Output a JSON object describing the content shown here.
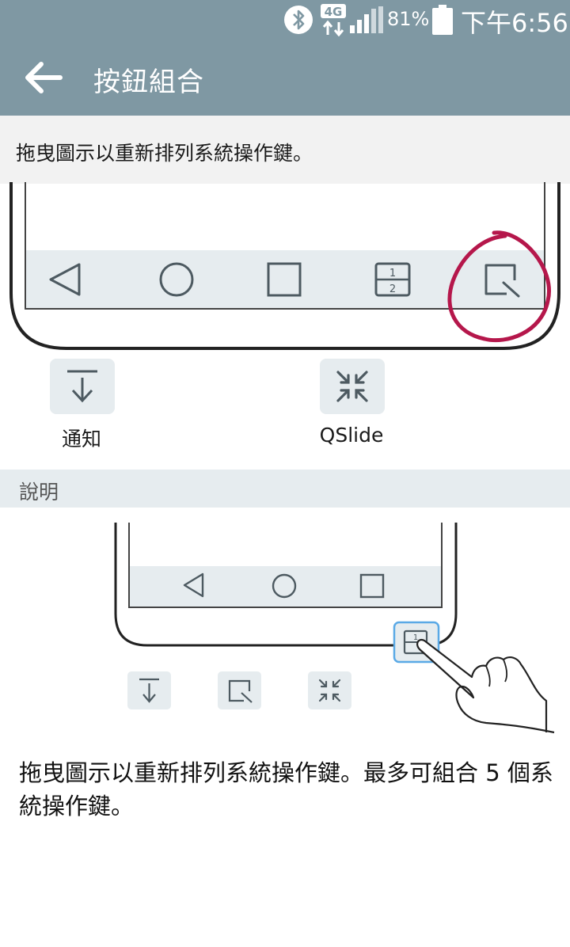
{
  "status_bar": {
    "network_label": "4G",
    "battery_percent": "81%",
    "time": "下午6:56",
    "icons": [
      "bluetooth-icon",
      "network-4g-icon",
      "signal-icon",
      "battery-icon"
    ]
  },
  "app_bar": {
    "title": "按鈕組合",
    "back_icon": "arrow-left-icon"
  },
  "instruction": "拖曳圖示以重新排列系統操作鍵。",
  "nav_preview": {
    "buttons": [
      {
        "name": "back",
        "icon": "triangle-back-icon"
      },
      {
        "name": "home",
        "icon": "circle-home-icon"
      },
      {
        "name": "recent",
        "icon": "square-recent-icon"
      },
      {
        "name": "dual-window",
        "icon": "dual-window-icon",
        "digits": [
          "1",
          "2"
        ]
      },
      {
        "name": "capture-plus",
        "icon": "capture-icon"
      }
    ]
  },
  "available_buttons": [
    {
      "label": "通知",
      "icon": "notification-down-icon"
    },
    {
      "label": "QSlide",
      "icon": "qslide-icon"
    }
  ],
  "help": {
    "section_title": "說明",
    "digit": "1",
    "text": "拖曳圖示以重新排列系統操作鍵。最多可組合 5 個系統操作鍵。"
  },
  "colors": {
    "app_bar": "#7f98a3",
    "nav_bar": "#e6ecef",
    "icon_stroke": "#4d5a61",
    "annotation": "#b5174b",
    "highlight": "#5aa9e6"
  }
}
